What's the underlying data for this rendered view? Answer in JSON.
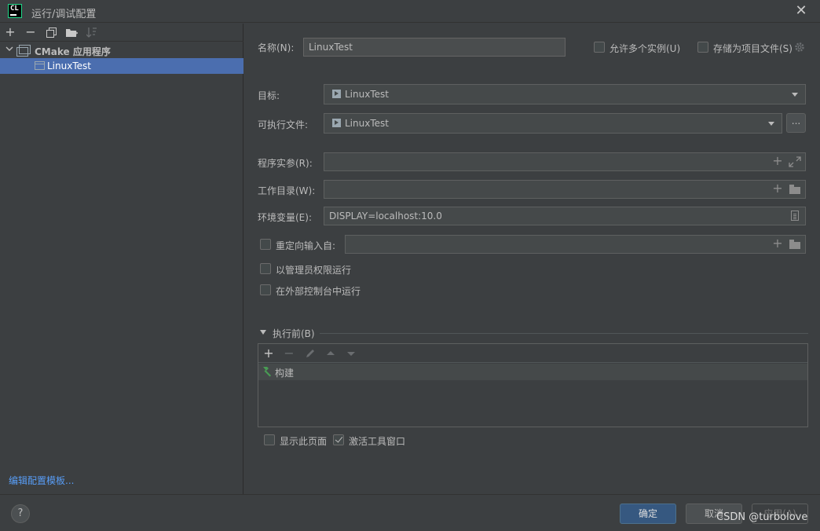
{
  "window": {
    "app_icon": "CL",
    "title": "运行/调试配置"
  },
  "sidebar": {
    "group_label": "CMake 应用程序",
    "items": [
      {
        "label": "LinuxTest"
      }
    ],
    "templates_link": "编辑配置模板..."
  },
  "form": {
    "name_label": "名称(N):",
    "name_value": "LinuxTest",
    "allow_multiple_label": "允许多个实例(U)",
    "allow_multiple_checked": false,
    "store_as_file_label": "存储为项目文件(S)",
    "store_as_file_checked": false,
    "target_label": "目标:",
    "target_value": "LinuxTest",
    "executable_label": "可执行文件:",
    "executable_value": "LinuxTest",
    "browse_label": "...",
    "program_args_label": "程序实参(R):",
    "program_args_value": "",
    "working_dir_label": "工作目录(W):",
    "working_dir_value": "",
    "env_label": "环境变量(E):",
    "env_value": "DISPLAY=localhost:10.0",
    "redirect_label": "重定向输入自:",
    "redirect_checked": false,
    "redirect_value": "",
    "run_as_admin_label": "以管理员权限运行",
    "run_as_admin_checked": false,
    "external_console_label": "在外部控制台中运行",
    "external_console_checked": false
  },
  "before_launch": {
    "title": "执行前(B)",
    "tasks": [
      {
        "label": "构建"
      }
    ],
    "show_page_label": "显示此页面",
    "show_page_checked": false,
    "activate_tool_label": "激活工具窗口",
    "activate_tool_checked": true
  },
  "buttons": {
    "help": "?",
    "ok": "确定",
    "cancel": "取消",
    "apply": "应用(A)"
  },
  "watermark": "CSDN @turbolove",
  "colors": {
    "background": "#3c3f41",
    "selection": "#4b6eaf",
    "link": "#589df6",
    "primary_button": "#365880",
    "build_icon": "#499c54"
  }
}
